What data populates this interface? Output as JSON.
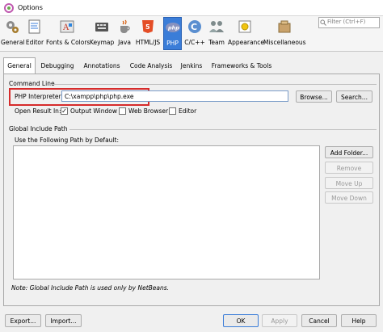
{
  "window": {
    "title": "Options"
  },
  "toolbar": {
    "items": [
      {
        "label": "General",
        "icon": "general-gear-icon",
        "selected": false
      },
      {
        "label": "Editor",
        "icon": "editor-icon",
        "selected": false
      },
      {
        "label": "Fonts & Colors",
        "icon": "fonts-colors-icon",
        "selected": false
      },
      {
        "label": "Keymap",
        "icon": "keymap-icon",
        "selected": false
      },
      {
        "label": "Java",
        "icon": "java-cup-icon",
        "selected": false
      },
      {
        "label": "HTML/JS",
        "icon": "html5-icon",
        "selected": false
      },
      {
        "label": "PHP",
        "icon": "php-icon",
        "selected": true
      },
      {
        "label": "C/C++",
        "icon": "cpp-icon",
        "selected": false
      },
      {
        "label": "Team",
        "icon": "team-icon",
        "selected": false
      },
      {
        "label": "Appearance",
        "icon": "appearance-icon",
        "selected": false
      },
      {
        "label": "Miscellaneous",
        "icon": "miscellaneous-icon",
        "selected": false
      }
    ],
    "filter_placeholder": "Filter (Ctrl+F)"
  },
  "tabs": [
    {
      "label": "General",
      "active": true
    },
    {
      "label": "Debugging",
      "active": false
    },
    {
      "label": "Annotations",
      "active": false
    },
    {
      "label": "Code Analysis",
      "active": false
    },
    {
      "label": "Jenkins",
      "active": false
    },
    {
      "label": "Frameworks & Tools",
      "active": false
    }
  ],
  "command_line": {
    "section_label": "Command Line",
    "interpreter_label": "PHP Interpreter:",
    "interpreter_value": "C:\\xampp\\php\\php.exe",
    "browse_label": "Browse...",
    "search_label": "Search...",
    "open_result_label": "Open Result In:",
    "options": [
      {
        "label": "Output Window",
        "checked": true
      },
      {
        "label": "Web Browser",
        "checked": false
      },
      {
        "label": "Editor",
        "checked": false
      }
    ]
  },
  "include_path": {
    "section_label": "Global Include Path",
    "list_label": "Use the Following Path by Default:",
    "add_folder_label": "Add Folder...",
    "remove_label": "Remove",
    "move_up_label": "Move Up",
    "move_down_label": "Move Down",
    "note": "Note: Global Include Path is used only by NetBeans."
  },
  "footer": {
    "export_label": "Export...",
    "import_label": "Import...",
    "ok_label": "OK",
    "apply_label": "Apply",
    "cancel_label": "Cancel",
    "help_label": "Help"
  },
  "colors": {
    "selected_tab": "#3b7dd8",
    "highlight_box": "#d62b2b"
  }
}
